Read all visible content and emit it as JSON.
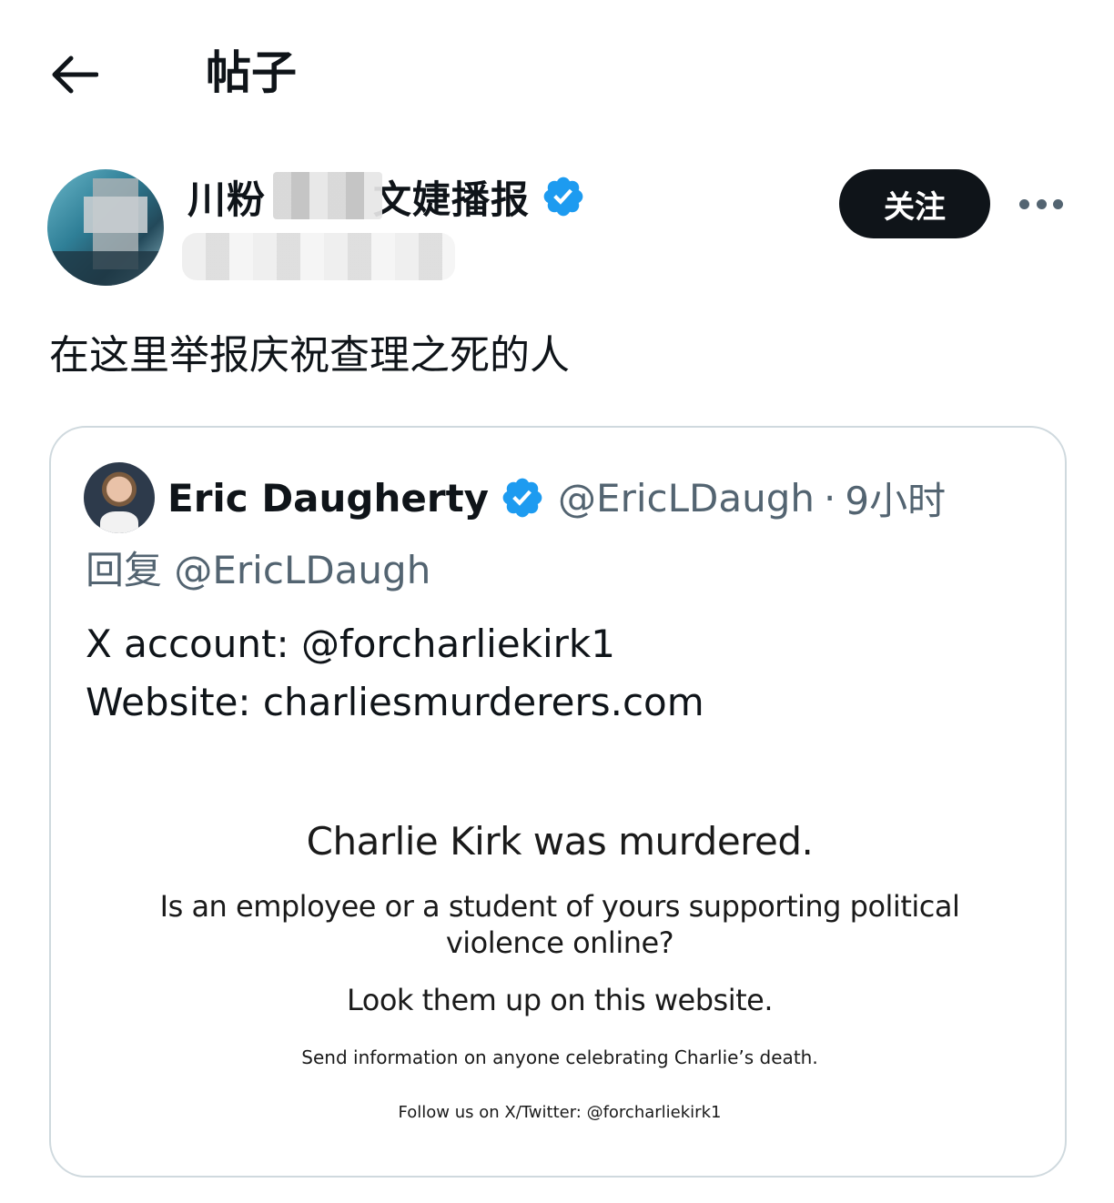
{
  "header": {
    "title": "帖子",
    "back_icon": "arrow-left-icon"
  },
  "post": {
    "author_name_visible_start": "川粉",
    "author_name_visible_end": "文婕播报",
    "verified_icon": "verified-badge-icon",
    "follow_label": "关注",
    "more_icon": "more-horizontal-icon",
    "text": "在这里举报庆祝查理之死的人"
  },
  "quote": {
    "name": "Eric Daugherty",
    "handle": "@EricLDaugh",
    "separator": "·",
    "time": "9小时",
    "reply_prefix": "回复",
    "reply_mention": "@EricLDaugh",
    "body_line1": "X account: @forcharliekirk1",
    "body_line2": "Website: charliesmurderers.com",
    "image": {
      "headline": "Charlie Kirk was murdered.",
      "question": "Is an employee or a student of yours supporting political violence online?",
      "cta": "Look them up on this website.",
      "send_info": "Send information on anyone celebrating Charlie’s death.",
      "follow_us": "Follow us on X/Twitter: @forcharliekirk1"
    }
  },
  "colors": {
    "text_primary": "#0f1419",
    "text_secondary": "#536471",
    "verified_blue": "#1d9bf0",
    "follow_bg": "#0f1419",
    "card_border": "#cfd9de"
  }
}
